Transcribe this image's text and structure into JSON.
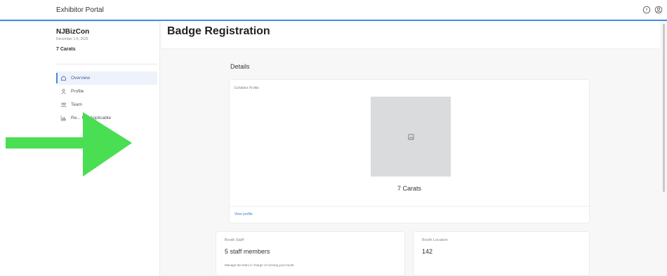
{
  "header": {
    "brand": "Exhibitor Portal"
  },
  "sidebar": {
    "event_name": "NJBizCon",
    "event_dates": "December 1-5, 2025",
    "company": "7 Carats",
    "items": [
      {
        "label": "Overview",
        "icon": "home-icon",
        "active": true
      },
      {
        "label": "Profile",
        "icon": "person-icon",
        "active": false
      },
      {
        "label": "Team",
        "icon": "people-icon",
        "active": false
      },
      {
        "label": "Re...  Not Applicable",
        "icon": "chart-icon",
        "active": false
      }
    ]
  },
  "main": {
    "title": "Badge Registration",
    "section": "Details",
    "profile_card": {
      "label": "Exhibitor Profile",
      "company": "7 Carats",
      "link": "View profile"
    },
    "staff_card": {
      "label": "Booth Staff",
      "value": "5 staff members",
      "hint": "Manage the team in charge of running your booth."
    },
    "location_card": {
      "label": "Booth Location",
      "value": "142"
    }
  },
  "colors": {
    "accent": "#3d8ee0",
    "arrow": "#4ade52"
  }
}
